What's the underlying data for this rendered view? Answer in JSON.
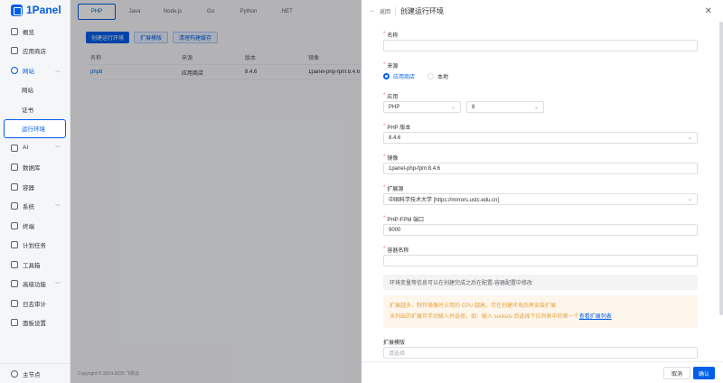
{
  "app": {
    "logo": "1Panel"
  },
  "sidebar": {
    "items": [
      {
        "label": "概览"
      },
      {
        "label": "应用商店"
      },
      {
        "label": "网站"
      },
      {
        "label": "网站"
      },
      {
        "label": "证书"
      },
      {
        "label": "运行环境"
      },
      {
        "label": "AI"
      },
      {
        "label": "数据库"
      },
      {
        "label": "容器"
      },
      {
        "label": "系统"
      },
      {
        "label": "终端"
      },
      {
        "label": "计划任务"
      },
      {
        "label": "工具箱"
      },
      {
        "label": "高级功能"
      },
      {
        "label": "日志审计"
      },
      {
        "label": "面板设置"
      }
    ],
    "user": "主节点"
  },
  "main": {
    "tabs": [
      "PHP",
      "Java",
      "Node.js",
      "Go",
      "Python",
      ".NET"
    ],
    "buttons": {
      "create": "创建运行环境",
      "extensions": "扩展模版",
      "clear_cache": "清理构建缓存"
    },
    "table": {
      "headers": [
        "名称",
        "来源",
        "版本",
        "镜像"
      ],
      "rows": [
        {
          "name": "php8",
          "source": "应用商店",
          "version": "8.4.6",
          "image": "1panel-php-fpm:8.4.6"
        }
      ]
    },
    "footer": "Copyright © 2014-2025 飞致云"
  },
  "drawer": {
    "back": "返回",
    "title": "创建运行环境",
    "fields": {
      "name": {
        "label": "名称",
        "value": ""
      },
      "source": {
        "label": "来源",
        "options": [
          "应用商店",
          "本地"
        ]
      },
      "app": {
        "label": "应用",
        "app_value": "PHP",
        "version_value": "8"
      },
      "php_version": {
        "label": "PHP 版本",
        "value": "8.4.6"
      },
      "image": {
        "label": "镜像",
        "value": "1panel-php-fpm:8.4.6"
      },
      "ext_source": {
        "label": "扩展源",
        "value": "中国科学技术大学 [https://mirrors.ustc.edu.cn]"
      },
      "port": {
        "label": "PHP-FPM 端口",
        "value": "9000"
      },
      "container": {
        "label": "容器名称",
        "value": ""
      }
    },
    "info": "环境变量等信息可以在创建完成之后在配置-容器配置中修改",
    "warning": {
      "line1": "扩展越多，制作镜像时占用的 CPU 越高，可在创建环境后再安装扩展",
      "line2": "未列出的扩展可手动输入并选择，如：输入 sockets 后选择下拉列表中的第一个",
      "link": "查看扩展列表"
    },
    "ext_template": {
      "label": "扩展模版",
      "placeholder": "请选择"
    },
    "cancel": "取消",
    "confirm": "确认"
  }
}
